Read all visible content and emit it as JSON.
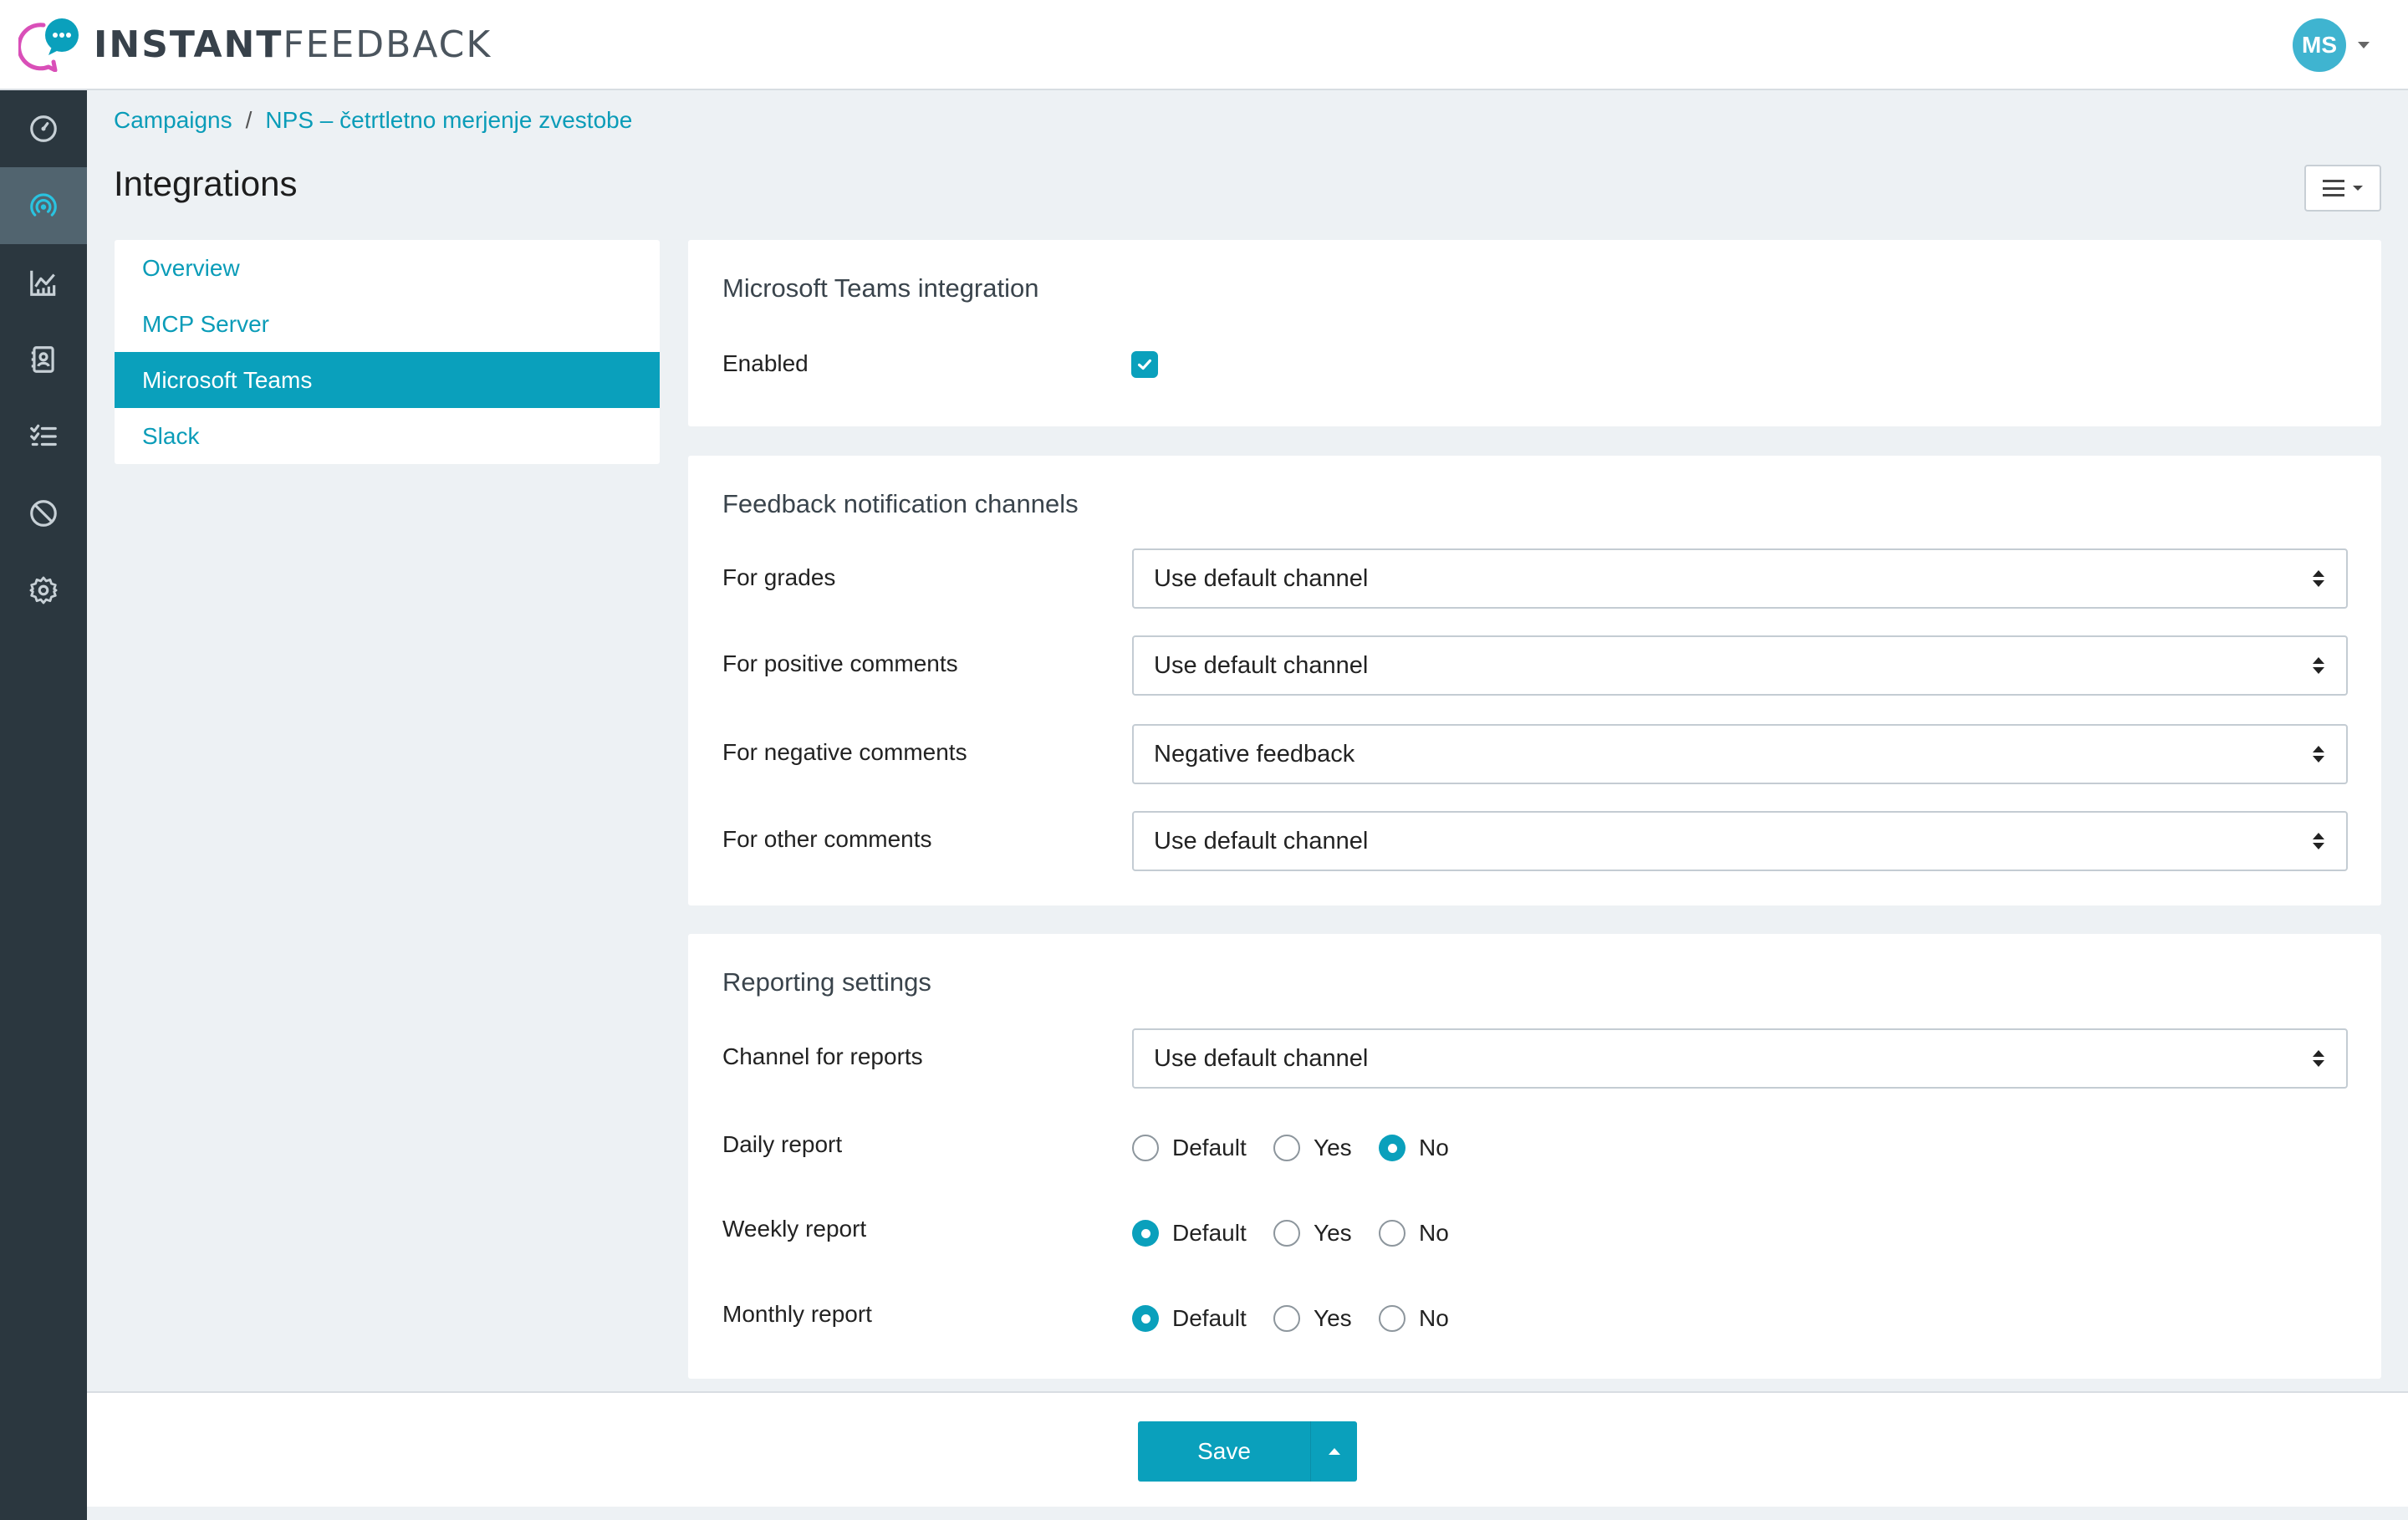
{
  "brand": {
    "name_bold": "INSTANT",
    "name_light": "FEEDBACK",
    "accent": "#0aa0bc",
    "logo_pink": "#d94fb8"
  },
  "user": {
    "initials": "MS",
    "avatar_color": "#3fb4d0"
  },
  "sidebar": {
    "items": [
      {
        "icon": "dashboard-gauge-icon",
        "active": false
      },
      {
        "icon": "campaign-signal-icon",
        "active": true
      },
      {
        "icon": "analytics-chart-icon",
        "active": false
      },
      {
        "icon": "contacts-book-icon",
        "active": false
      },
      {
        "icon": "task-list-icon",
        "active": false
      },
      {
        "icon": "block-icon",
        "active": false
      },
      {
        "icon": "settings-gear-icon",
        "active": false
      }
    ]
  },
  "breadcrumb": {
    "items": [
      "Campaigns",
      "NPS – četrtletno merjenje zvestobe"
    ],
    "separator": "/"
  },
  "page": {
    "title": "Integrations"
  },
  "subnav": {
    "items": [
      {
        "label": "Overview",
        "active": false
      },
      {
        "label": "MCP Server",
        "active": false
      },
      {
        "label": "Microsoft Teams",
        "active": true
      },
      {
        "label": "Slack",
        "active": false
      }
    ]
  },
  "teams": {
    "title": "Microsoft Teams integration",
    "enabled_label": "Enabled",
    "enabled": true
  },
  "channels": {
    "title": "Feedback notification channels",
    "rows": [
      {
        "label": "For grades",
        "value": "Use default channel"
      },
      {
        "label": "For positive comments",
        "value": "Use default channel"
      },
      {
        "label": "For negative comments",
        "value": "Negative feedback"
      },
      {
        "label": "For other comments",
        "value": "Use default channel"
      }
    ]
  },
  "reporting": {
    "title": "Reporting settings",
    "channel_label": "Channel for reports",
    "channel_value": "Use default channel",
    "options": [
      "Default",
      "Yes",
      "No"
    ],
    "reports": [
      {
        "label": "Daily report",
        "selected": "No"
      },
      {
        "label": "Weekly report",
        "selected": "Default"
      },
      {
        "label": "Monthly report",
        "selected": "Default"
      }
    ]
  },
  "footer": {
    "save_label": "Save"
  }
}
